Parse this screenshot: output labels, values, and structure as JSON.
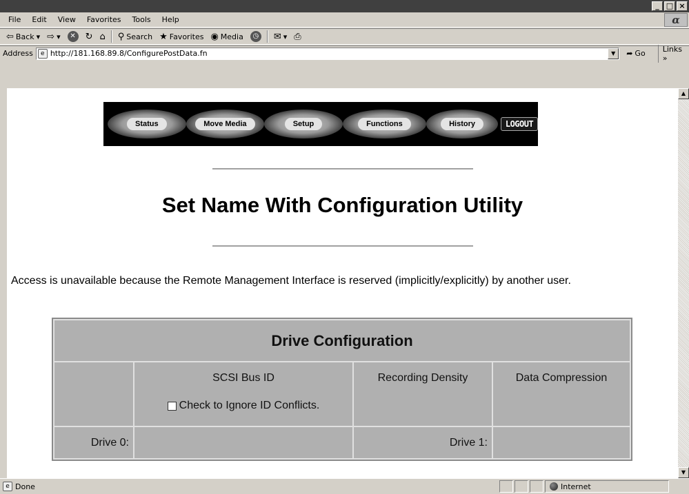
{
  "window": {
    "controls": [
      "_",
      "□",
      "×"
    ]
  },
  "menubar": {
    "items": [
      "File",
      "Edit",
      "View",
      "Favorites",
      "Tools",
      "Help"
    ]
  },
  "toolbar": {
    "back": "Back",
    "search": "Search",
    "favorites": "Favorites",
    "media": "Media"
  },
  "address": {
    "label": "Address",
    "url": "http://181.168.89.8/ConfigurePostData.fn",
    "go": "Go",
    "links": "Links »"
  },
  "nav": {
    "buttons": [
      "Status",
      "Move Media",
      "Setup",
      "Functions",
      "History"
    ],
    "logout": "LOGOUT"
  },
  "page": {
    "title": "Set Name With Configuration Utility",
    "message": "Access is unavailable because the Remote Management Interface is reserved (implicitly/explicitly) by another user."
  },
  "drive_config": {
    "title": "Drive Configuration",
    "columns": [
      "",
      "SCSI Bus ID",
      "Recording Density",
      "Data Compression"
    ],
    "ignore_conflicts_label": "Check to Ignore ID Conflicts.",
    "ignore_conflicts_checked": false,
    "rows": [
      {
        "label_left": "Drive 0:",
        "label_right": "Drive 1:"
      }
    ]
  },
  "status": {
    "text": "Done",
    "zone": "Internet"
  },
  "icons": {
    "page": "ie-page-icon",
    "globe": "internet-globe-icon"
  }
}
